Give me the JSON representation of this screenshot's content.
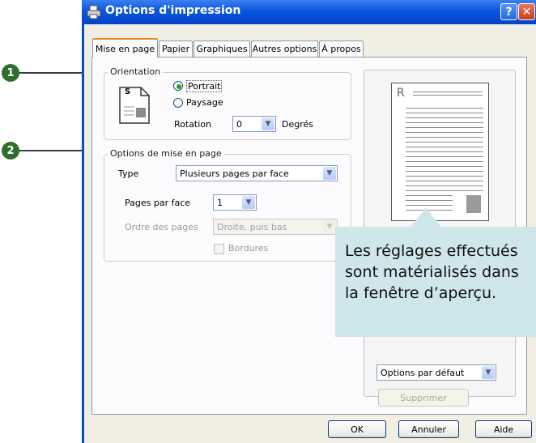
{
  "callouts": [
    "1",
    "2"
  ],
  "window": {
    "title": "Options d'impression",
    "help_button": "?",
    "close_button": "✕"
  },
  "tabs": [
    "Mise en page",
    "Papier",
    "Graphiques",
    "Autres options",
    "À propos"
  ],
  "orientation": {
    "title": "Orientation",
    "portrait": "Portrait",
    "landscape": "Paysage",
    "rotation_label": "Rotation",
    "rotation_value": "0",
    "degrees_label": "Degrés",
    "selected": "Portrait",
    "icon_letter": "S"
  },
  "layout_options": {
    "title": "Options de mise en page",
    "type_label": "Type",
    "type_value": "Plusieurs pages par face",
    "pages_per_side_label": "Pages par face",
    "pages_per_side_value": "1",
    "page_order_label": "Ordre des pages",
    "page_order_value": "Droite, puis bas",
    "borders_label": "Bordures"
  },
  "preview": {
    "letter": "R",
    "favorites_value": "Options par défaut",
    "delete_button": "Supprimer"
  },
  "tooltip": {
    "text": "Les réglages effectués sont matérialisés dans la fenêtre d’aperçu."
  },
  "footer": {
    "ok": "OK",
    "cancel": "Annuler",
    "help": "Aide"
  },
  "colors": {
    "titlebar": "#0a55de",
    "callout_badge": "#2e6e2e",
    "tooltip_bg": "#cfe6ea",
    "active_tab_accent": "#e68b2c"
  }
}
